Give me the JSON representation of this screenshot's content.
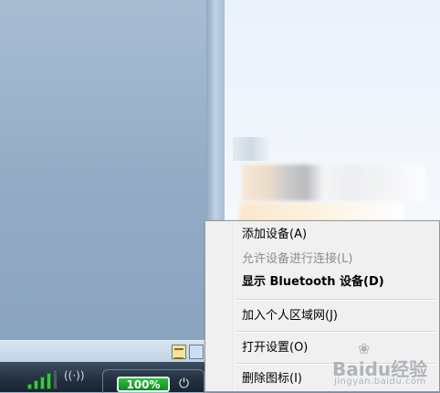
{
  "context_menu": {
    "items": [
      {
        "label": "添加设备(A)",
        "enabled": true,
        "bold": false
      },
      {
        "label": "允许设备进行连接(L)",
        "enabled": false,
        "bold": false
      },
      {
        "label": "显示 Bluetooth 设备(D)",
        "enabled": true,
        "bold": true
      },
      {
        "label": "加入个人区域网(J)",
        "enabled": true,
        "bold": false
      },
      {
        "label": "打开设置(O)",
        "enabled": true,
        "bold": false
      },
      {
        "label": "删除图标(I)",
        "enabled": true,
        "bold": false
      }
    ]
  },
  "taskbar": {
    "battery_percent": "100%",
    "signal_level": 0.8
  },
  "watermark": {
    "brand": "Baidu经验",
    "url": "jingyan.baidu.com"
  },
  "colors": {
    "menu_bg": "#f0f0f0",
    "battery_green": "#2fbf3c",
    "signal_green": "#3ec34a"
  }
}
